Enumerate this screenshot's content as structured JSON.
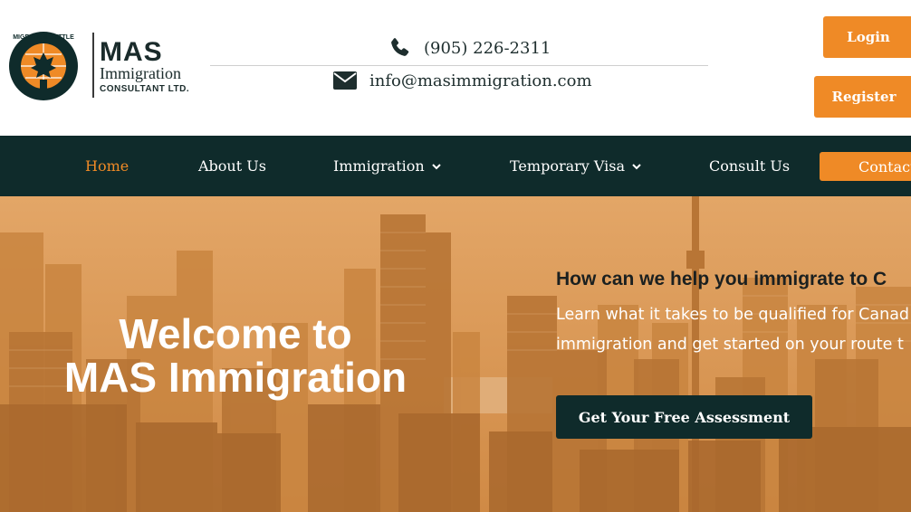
{
  "brand": {
    "name": "MAS",
    "line2": "Immigration",
    "line3": "CONSULTANT LTD.",
    "emblem_text": "MIGRATE & SETTLE"
  },
  "contact": {
    "phone": "(905) 226-2311",
    "email": "info@masimmigration.com"
  },
  "auth": {
    "login_label": "Login",
    "register_label": "Register"
  },
  "nav": {
    "items": [
      {
        "label": "Home"
      },
      {
        "label": "About Us"
      },
      {
        "label": "Immigration"
      },
      {
        "label": "Temporary Visa"
      },
      {
        "label": "Consult Us"
      }
    ],
    "contact_label": "Contact"
  },
  "hero": {
    "welcome_line1": "Welcome to",
    "welcome_line2": "MAS Immigration",
    "help_title": "How can we help you immigrate to C",
    "help_line1": "Learn what it takes to be qualified for Canad",
    "help_line2": "immigration and get started on your route t",
    "cta_label": "Get Your Free Assessment"
  },
  "colors": {
    "accent": "#ef8a26",
    "dark": "#0f2b2b",
    "hero_tint": "#d89552"
  },
  "icons": {
    "phone": "phone-icon",
    "email": "envelope-icon",
    "dropdown": "chevron-down-icon"
  }
}
